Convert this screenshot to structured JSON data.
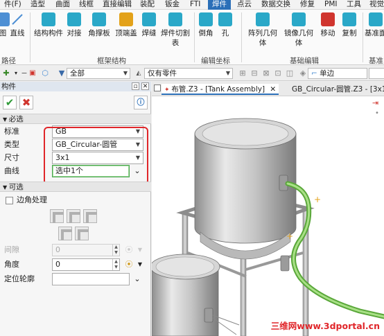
{
  "menubar": {
    "items": [
      "件(F)",
      "造型",
      "曲面",
      "线框",
      "直接编辑",
      "装配",
      "钣金",
      "FTI",
      "焊件",
      "点云",
      "数据交换",
      "修复",
      "PMI",
      "工具",
      "视觉"
    ],
    "active_index": 8
  },
  "ribbon": {
    "buttons": [
      {
        "label": "图",
        "icon": "partial-icon",
        "color": "#4d8fd4"
      },
      {
        "label": "直线",
        "icon": "line-icon",
        "color": "#4d8fd4"
      },
      {
        "label": "结构构件",
        "icon": "structural-member-icon",
        "color": "#2aa8c8"
      },
      {
        "label": "对接",
        "icon": "butt-joint-icon",
        "color": "#2aa8c8"
      },
      {
        "label": "角撑板",
        "icon": "gusset-icon",
        "color": "#2aa8c8"
      },
      {
        "label": "顶端盖",
        "icon": "end-cap-icon",
        "color": "#e3a21a"
      },
      {
        "label": "焊缝",
        "icon": "weld-bead-icon",
        "color": "#2aa8c8"
      },
      {
        "label": "焊件切割表",
        "icon": "cut-list-icon",
        "color": "#2aa8c8"
      },
      {
        "label": "倒角",
        "icon": "chamfer-icon",
        "color": "#2aa8c8"
      },
      {
        "label": "孔",
        "icon": "hole-icon",
        "color": "#2aa8c8"
      },
      {
        "label": "阵列几何体",
        "icon": "pattern-icon",
        "color": "#2aa8c8"
      },
      {
        "label": "镜像几何体",
        "icon": "mirror-icon",
        "color": "#2aa8c8"
      },
      {
        "label": "移动",
        "icon": "move-icon",
        "color": "#d0352e"
      },
      {
        "label": "复制",
        "icon": "copy-icon",
        "color": "#2aa8c8"
      },
      {
        "label": "基准面",
        "icon": "datum-plane-icon",
        "color": "#2aa8c8"
      }
    ],
    "groups": [
      "路径",
      "框架结构",
      "编辑坐标",
      "基础编辑",
      "基准"
    ]
  },
  "toolbar": {
    "filter_all": "全部",
    "filter_parts": "仅有零件",
    "select_mode": "单边"
  },
  "panel": {
    "title": "构件",
    "section_required": "必选",
    "section_optional": "可选",
    "fields": {
      "standard": {
        "label": "标准",
        "value": "GB"
      },
      "type": {
        "label": "类型",
        "value": "GB_Circular-圆管"
      },
      "size": {
        "label": "尺寸",
        "value": "3x1"
      },
      "curve": {
        "label": "曲线",
        "value": "选中1个"
      }
    },
    "corner_label": "边角处理",
    "gap": {
      "label": "间隙",
      "value": "0"
    },
    "angle": {
      "label": "角度",
      "value": "0"
    },
    "profile": {
      "label": "定位轮廓",
      "value": ""
    }
  },
  "viewport": {
    "tabs": [
      "布管.Z3 - [Tank Assembly]",
      "GB_Circular-圆管.Z3 - [3x1]"
    ],
    "watermark": "三维网www.3dportal.cn",
    "colors": {
      "pipe": "#8fd06a",
      "tank": "#c9c9c9",
      "redbox": "#e0262a"
    }
  }
}
